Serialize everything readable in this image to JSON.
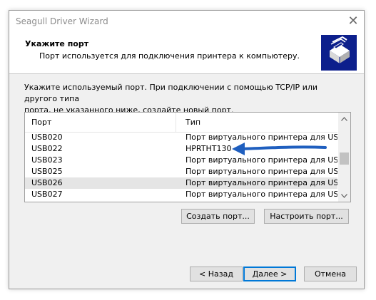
{
  "window": {
    "title": "Seagull Driver Wizard",
    "close_glyph": "✕"
  },
  "header": {
    "title": "Укажите порт",
    "subtitle": "Порт используется для подключения принтера к компьютеру.",
    "logo_icon": "printer-icon"
  },
  "body": {
    "line1": "Укажите используемый порт. При подключении с помощью TCP/IP или другого типа",
    "line2": "порта, не указанного ниже, создайте новый порт."
  },
  "list": {
    "columns": [
      "Порт",
      "Тип"
    ],
    "rows": [
      {
        "port": "USB020",
        "type": "Порт виртуального принтера для USB"
      },
      {
        "port": "USB022",
        "type": "HPRTHT130"
      },
      {
        "port": "USB023",
        "type": "Порт виртуального принтера для USB"
      },
      {
        "port": "USB025",
        "type": "Порт виртуального принтера для USB"
      },
      {
        "port": "USB026",
        "type": "Порт виртуального принтера для USB"
      },
      {
        "port": "USB027",
        "type": "Порт виртуального принтера для USB"
      }
    ],
    "scroll_up_glyph": "⌃",
    "scroll_down_glyph": "⌄"
  },
  "buttons": {
    "create_port": "Создать порт...",
    "configure_port": "Настроить порт...",
    "back": "< Назад",
    "next": "Далее >",
    "cancel": "Отмена"
  },
  "colors": {
    "annotation_arrow": "#1f5fbf",
    "logo_bg": "#0c1f8c",
    "selected_row": "#e5e5e5"
  }
}
